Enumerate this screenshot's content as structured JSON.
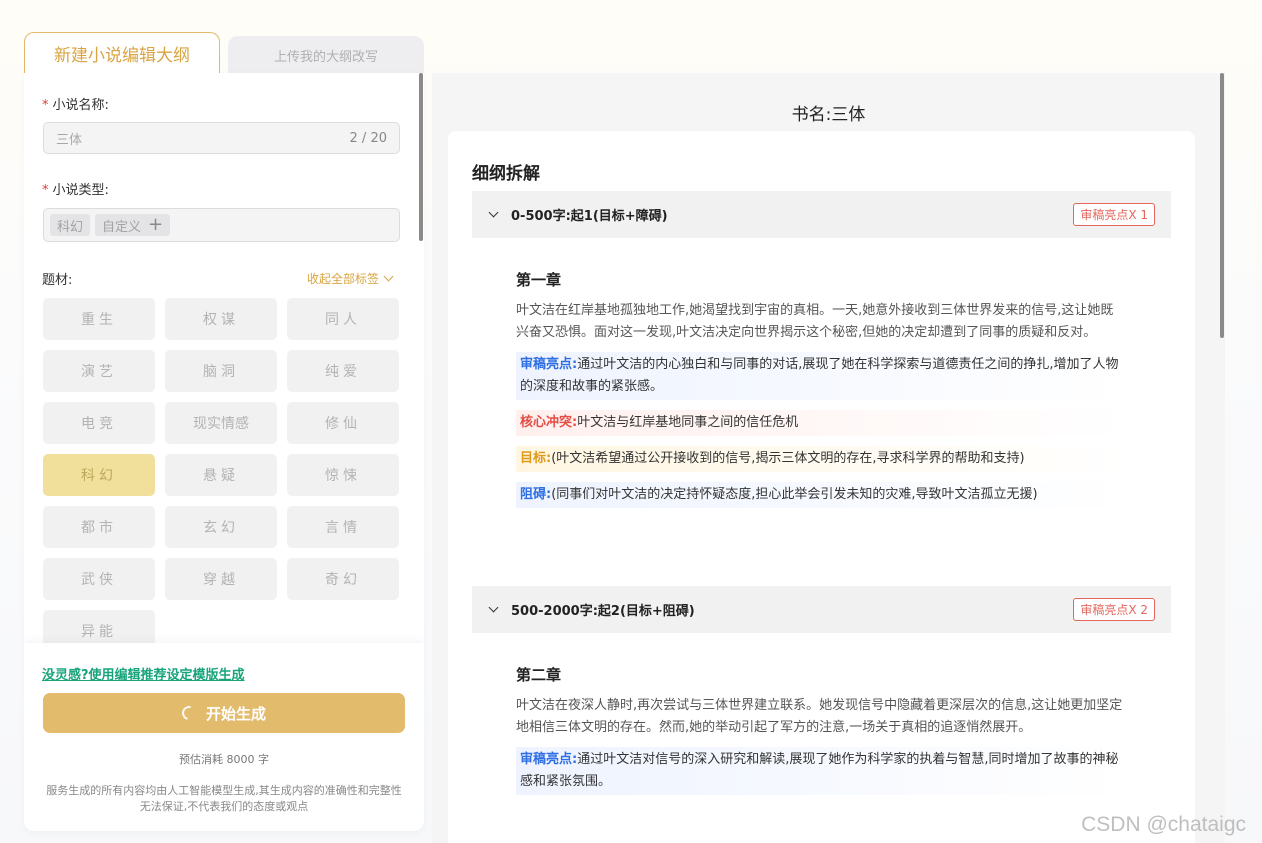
{
  "tabs": {
    "new_outline": "新建小说编辑大纲",
    "upload_outline": "上传我的大纲改写"
  },
  "form": {
    "name_label": "小说名称:",
    "name_value": "三体",
    "name_count": "2 / 20",
    "type_label": "小说类型:",
    "type_tags": [
      "科幻",
      "自定义"
    ],
    "theme_label": "题材:",
    "collapse_label": "收起全部标签",
    "genres": [
      {
        "label": "重生",
        "selected": false
      },
      {
        "label": "权谋",
        "selected": false
      },
      {
        "label": "同人",
        "selected": false
      },
      {
        "label": "演艺",
        "selected": false
      },
      {
        "label": "脑洞",
        "selected": false
      },
      {
        "label": "纯爱",
        "selected": false
      },
      {
        "label": "电竞",
        "selected": false
      },
      {
        "label": "现实情感",
        "selected": false
      },
      {
        "label": "修仙",
        "selected": false
      },
      {
        "label": "科幻",
        "selected": true
      },
      {
        "label": "悬疑",
        "selected": false
      },
      {
        "label": "惊悚",
        "selected": false
      },
      {
        "label": "都市",
        "selected": false
      },
      {
        "label": "玄幻",
        "selected": false
      },
      {
        "label": "言情",
        "selected": false
      },
      {
        "label": "武侠",
        "selected": false
      },
      {
        "label": "穿越",
        "selected": false
      },
      {
        "label": "奇幻",
        "selected": false
      },
      {
        "label": "异能",
        "selected": false
      }
    ]
  },
  "bottom": {
    "template_link": "没灵感?使用编辑推荐设定模版生成",
    "generate_label": "开始生成",
    "cost": "预估消耗 8000 字",
    "disclaimer": "服务生成的所有内容均由人工智能模型生成,其生成内容的准确性和完整性无法保证,不代表我们的态度或观点"
  },
  "preview": {
    "book_title": "书名:三体",
    "heading": "细纲拆解",
    "sections": [
      {
        "range": "0-500字:起1(目标+障碍)",
        "badge": "审稿亮点X 1",
        "chapter": "第一章",
        "body": "叶文洁在红岸基地孤独地工作,她渴望找到宇宙的真相。一天,她意外接收到三体世界发来的信号,这让她既兴奋又恐惧。面对这一发现,叶文洁决定向世界揭示这个秘密,但她的决定却遭到了同事的质疑和反对。",
        "review_label": "审稿亮点:",
        "review_text": "通过叶文洁的内心独白和与同事的对话,展现了她在科学探索与道德责任之间的挣扎,增加了人物的深度和故事的紧张感。",
        "conflict_label": "核心冲突:",
        "conflict_text": "叶文洁与红岸基地同事之间的信任危机",
        "goal_label": "目标:",
        "goal_text": "(叶文洁希望通过公开接收到的信号,揭示三体文明的存在,寻求科学界的帮助和支持)",
        "obstacle_label": "阻碍:",
        "obstacle_text": "(同事们对叶文洁的决定持怀疑态度,担心此举会引发未知的灾难,导致叶文洁孤立无援)"
      },
      {
        "range": "500-2000字:起2(目标+阻碍)",
        "badge": "审稿亮点X 2",
        "chapter": "第二章",
        "body": "叶文洁在夜深人静时,再次尝试与三体世界建立联系。她发现信号中隐藏着更深层次的信息,这让她更加坚定地相信三体文明的存在。然而,她的举动引起了军方的注意,一场关于真相的追逐悄然展开。",
        "review_label": "审稿亮点:",
        "review_text": "通过叶文洁对信号的深入研究和解读,展现了她作为科学家的执着与智慧,同时增加了故事的神秘感和紧张氛围。"
      }
    ]
  },
  "watermark": "CSDN @chataigc"
}
